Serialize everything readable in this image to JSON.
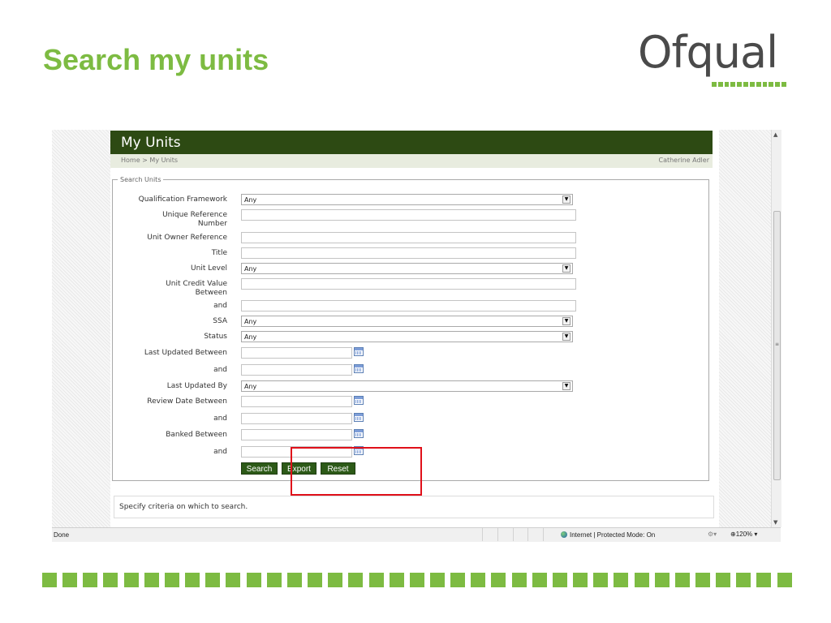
{
  "slide": {
    "title": "Search my units",
    "logo_text": "Ofqual",
    "brand_green": "#7dbb42"
  },
  "app": {
    "header_title": "My Units",
    "breadcrumb": "Home > My Units",
    "user": "Catherine Adler"
  },
  "search": {
    "legend": "Search Units",
    "fields": {
      "qualification_framework": {
        "label": "Qualification Framework",
        "value": "Any"
      },
      "urn": {
        "label": "Unique Reference Number",
        "value": ""
      },
      "unit_owner_reference": {
        "label": "Unit Owner Reference",
        "value": ""
      },
      "title": {
        "label": "Title",
        "value": ""
      },
      "unit_level": {
        "label": "Unit Level",
        "value": "Any"
      },
      "credit_value_between": {
        "label": "Unit Credit Value Between",
        "value": ""
      },
      "credit_value_and": {
        "label": "and",
        "value": ""
      },
      "ssa": {
        "label": "SSA",
        "value": "Any"
      },
      "status": {
        "label": "Status",
        "value": "Any"
      },
      "last_updated_between": {
        "label": "Last Updated Between",
        "value": ""
      },
      "last_updated_and": {
        "label": "and",
        "value": ""
      },
      "last_updated_by": {
        "label": "Last Updated By",
        "value": "Any"
      },
      "review_date_between": {
        "label": "Review Date Between",
        "value": ""
      },
      "review_date_and": {
        "label": "and",
        "value": ""
      },
      "banked_between": {
        "label": "Banked Between",
        "value": ""
      },
      "banked_and": {
        "label": "and",
        "value": ""
      }
    },
    "buttons": {
      "search": "Search",
      "export": "Export",
      "reset": "Reset"
    },
    "highlight_color": "#e0101a"
  },
  "info": {
    "message": "Specify criteria on which to search."
  },
  "statusbar": {
    "left": "Done",
    "zone": "Internet | Protected Mode: On",
    "zoom": "120%"
  },
  "icons": {
    "calendar": "calendar-icon",
    "dropdown": "chevron-down-icon",
    "globe": "globe-icon"
  }
}
